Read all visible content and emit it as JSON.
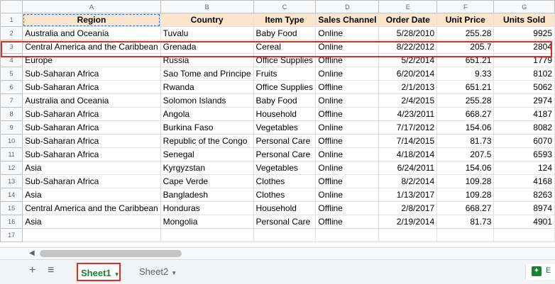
{
  "column_letters": [
    "A",
    "B",
    "C",
    "D",
    "E",
    "F",
    "G"
  ],
  "row_numbers": [
    "1",
    "2",
    "3",
    "4",
    "5",
    "6",
    "7",
    "8",
    "9",
    "10",
    "11",
    "12",
    "13",
    "14",
    "15",
    "16",
    "17"
  ],
  "headers": [
    "Region",
    "Country",
    "Item Type",
    "Sales Channel",
    "Order Date",
    "Unit Price",
    "Units Sold"
  ],
  "rows": [
    [
      "Australia and Oceania",
      "Tuvalu",
      "Baby Food",
      "Online",
      "5/28/2010",
      "255.28",
      "9925"
    ],
    [
      "Central America and the Caribbean",
      "Grenada",
      "Cereal",
      "Online",
      "8/22/2012",
      "205.7",
      "2804"
    ],
    [
      "Europe",
      "Russia",
      "Office Supplies",
      "Offline",
      "5/2/2014",
      "651.21",
      "1779"
    ],
    [
      "Sub-Saharan Africa",
      "Sao Tome and Principe",
      "Fruits",
      "Online",
      "6/20/2014",
      "9.33",
      "8102"
    ],
    [
      "Sub-Saharan Africa",
      "Rwanda",
      "Office Supplies",
      "Offline",
      "2/1/2013",
      "651.21",
      "5062"
    ],
    [
      "Australia and Oceania",
      "Solomon Islands",
      "Baby Food",
      "Online",
      "2/4/2015",
      "255.28",
      "2974"
    ],
    [
      "Sub-Saharan Africa",
      "Angola",
      "Household",
      "Offline",
      "4/23/2011",
      "668.27",
      "4187"
    ],
    [
      "Sub-Saharan Africa",
      "Burkina Faso",
      "Vegetables",
      "Online",
      "7/17/2012",
      "154.06",
      "8082"
    ],
    [
      "Sub-Saharan Africa",
      "Republic of the Congo",
      "Personal Care",
      "Offline",
      "7/14/2015",
      "81.73",
      "6070"
    ],
    [
      "Sub-Saharan Africa",
      "Senegal",
      "Personal Care",
      "Online",
      "4/18/2014",
      "207.5",
      "6593"
    ],
    [
      "Asia",
      "Kyrgyzstan",
      "Vegetables",
      "Online",
      "6/24/2011",
      "154.06",
      "124"
    ],
    [
      "Sub-Saharan Africa",
      "Cape Verde",
      "Clothes",
      "Offline",
      "8/2/2014",
      "109.28",
      "4168"
    ],
    [
      "Asia",
      "Bangladesh",
      "Clothes",
      "Online",
      "1/13/2017",
      "109.28",
      "8263"
    ],
    [
      "Central America and the Caribbean",
      "Honduras",
      "Household",
      "Offline",
      "2/8/2017",
      "668.27",
      "8974"
    ],
    [
      "Asia",
      "Mongolia",
      "Personal Care",
      "Offline",
      "2/19/2014",
      "81.73",
      "4901"
    ]
  ],
  "tabs": [
    {
      "label": "Sheet1",
      "active": true
    },
    {
      "label": "Sheet2",
      "active": false
    }
  ],
  "explore_label": "E",
  "icons": {
    "add_sheet": "plus-icon",
    "all_sheets": "list-icon",
    "tab_menu": "caret-down-icon",
    "scroll_left": "chevron-left-icon",
    "explore": "explore-icon"
  },
  "colors": {
    "header_fill": "#fce5cd",
    "highlight": "#d93025",
    "active_tab": "#188038"
  }
}
